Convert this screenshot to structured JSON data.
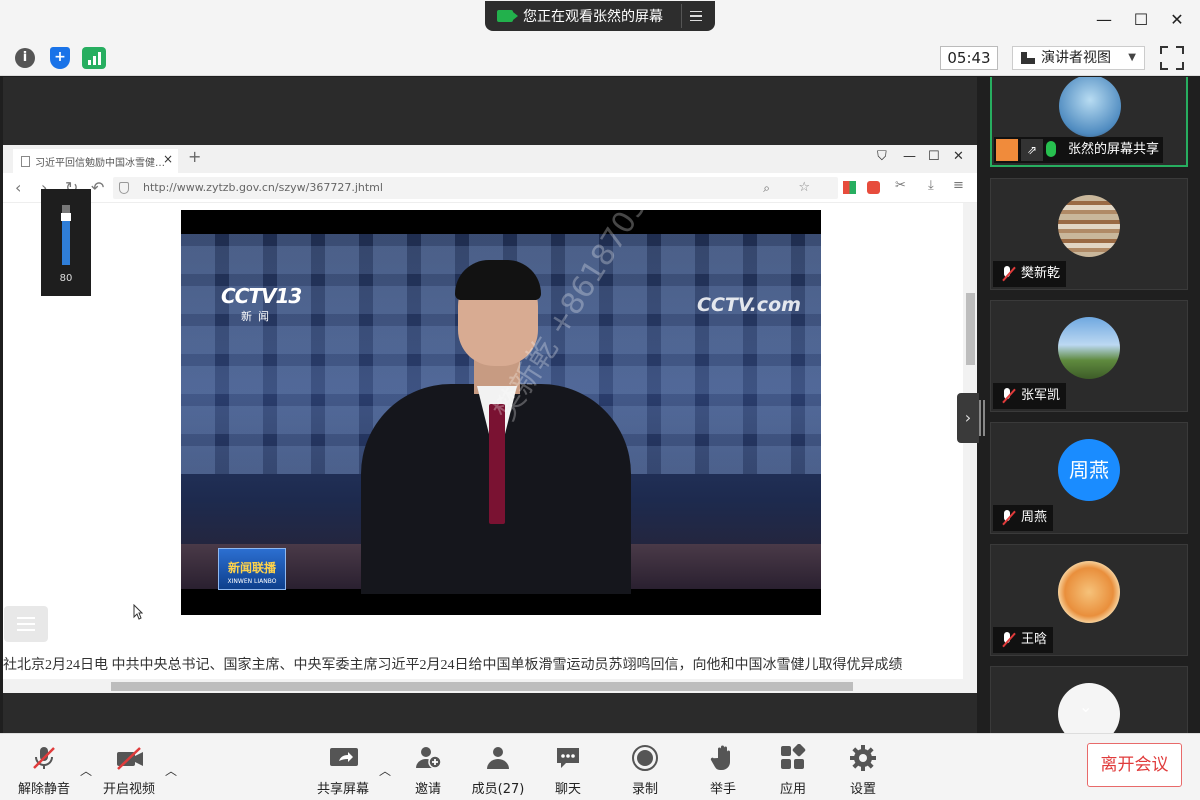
{
  "window": {
    "share_banner": "您正在观看张然的屏幕",
    "minimize": "—",
    "maximize": "☐",
    "close": "✕"
  },
  "top_toolbar": {
    "timer": "05:43",
    "view_mode": "演讲者视图",
    "info_icon": "i",
    "shield_icon": "+"
  },
  "browser": {
    "tab_title": "习近平回信勉励中国冰雪健…",
    "url": "http://www.zytzb.gov.cn/szyw/367727.jhtml",
    "volume_value": "80",
    "volume_level": 0.8,
    "article_text": "社北京2月24日电  中共中央总书记、国家主席、中央军委主席习近平2月24日给中国单板滑雪运动员苏翊鸣回信，向他和中国冰雪健儿取得优异成绩"
  },
  "video": {
    "logo_left": "CCTV13",
    "logo_left_sub": "新闻",
    "logo_right": "CCTV.com",
    "program_logo": "新闻联播",
    "program_logo_sub": "XINWEN LIANBO",
    "watermark": "樊新乾 +8618703396269"
  },
  "gallery": {
    "tiles": [
      {
        "name": "张然的屏幕共享",
        "type": "sharing",
        "active": true
      },
      {
        "name": "樊新乾",
        "type": "muted"
      },
      {
        "name": "张军凯",
        "type": "muted"
      },
      {
        "name": "周燕",
        "type": "muted",
        "avatar_text": "周燕"
      },
      {
        "name": "王晗",
        "type": "muted"
      }
    ]
  },
  "bottom_toolbar": {
    "unmute": "解除静音",
    "start_video": "开启视频",
    "share_screen": "共享屏幕",
    "invite": "邀请",
    "members": "成员(27)",
    "chat": "聊天",
    "record": "录制",
    "raise_hand": "举手",
    "apps": "应用",
    "settings": "设置",
    "leave": "离开会议"
  },
  "colors": {
    "accent_green": "#27ae60",
    "leave_red": "#e03b3b",
    "brand_blue": "#1a73e8"
  }
}
